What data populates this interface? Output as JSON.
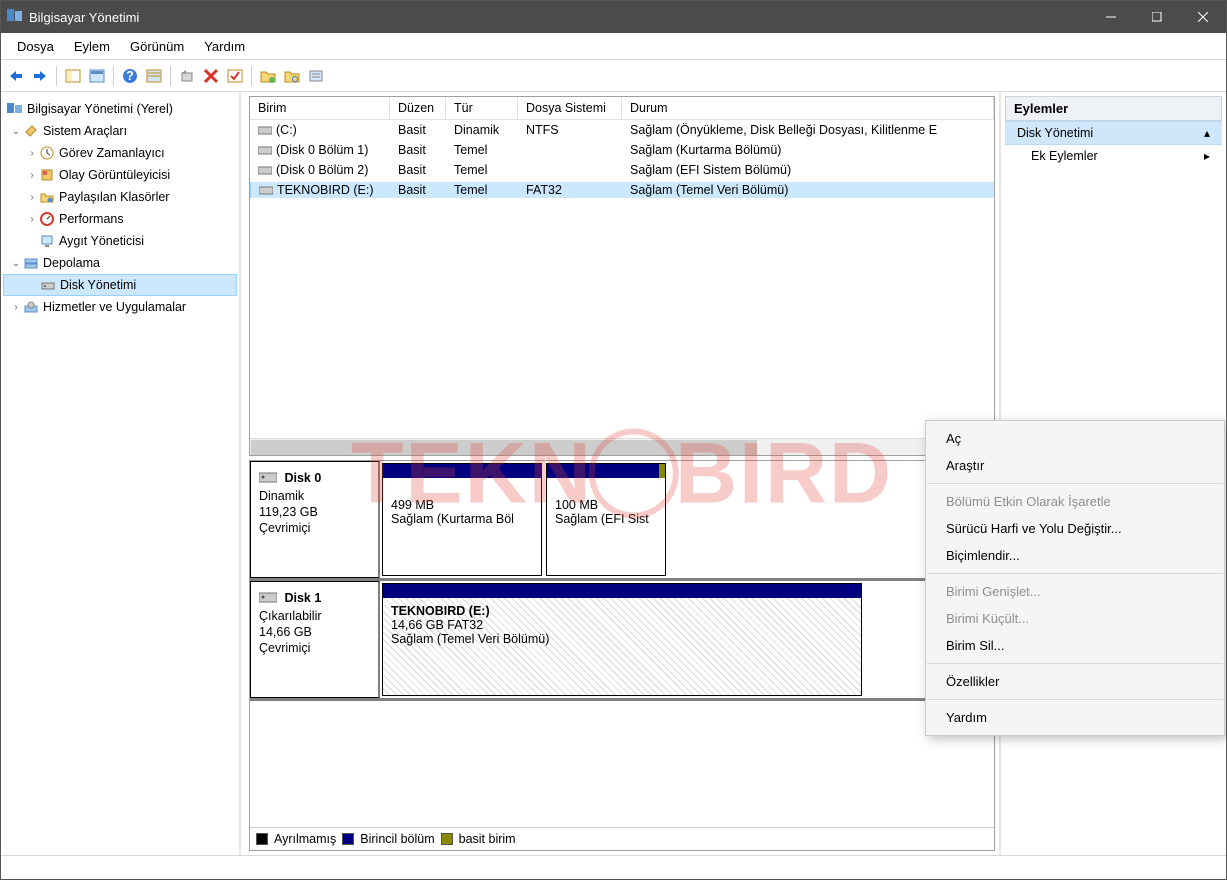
{
  "title": "Bilgisayar Yönetimi",
  "menubar": [
    "Dosya",
    "Eylem",
    "Görünüm",
    "Yardım"
  ],
  "tree": {
    "root": "Bilgisayar Yönetimi (Yerel)",
    "sys_tools": "Sistem Araçları",
    "task_sched": "Görev Zamanlayıcı",
    "event_viewer": "Olay Görüntüleyicisi",
    "shared": "Paylaşılan Klasörler",
    "perf": "Performans",
    "devmgr": "Aygıt Yöneticisi",
    "storage": "Depolama",
    "diskmgmt": "Disk Yönetimi",
    "services": "Hizmetler ve Uygulamalar"
  },
  "columns": [
    "Birim",
    "Düzen",
    "Tür",
    "Dosya Sistemi",
    "Durum"
  ],
  "volumes": [
    {
      "name": " (C:)",
      "layout": "Basit",
      "type": "Dinamik",
      "fs": "NTFS",
      "status": "Sağlam (Önyükleme, Disk Belleği Dosyası, Kilitlenme E"
    },
    {
      "name": " (Disk 0 Bölüm 1)",
      "layout": "Basit",
      "type": "Temel",
      "fs": "",
      "status": "Sağlam (Kurtarma Bölümü)"
    },
    {
      "name": " (Disk 0 Bölüm 2)",
      "layout": "Basit",
      "type": "Temel",
      "fs": "",
      "status": "Sağlam (EFI Sistem Bölümü)"
    },
    {
      "name": " TEKNOBIRD (E:)",
      "layout": "Basit",
      "type": "Temel",
      "fs": "FAT32",
      "status": "Sağlam (Temel Veri Bölümü)"
    }
  ],
  "disk0": {
    "title": "Disk 0",
    "l1": "Dinamik",
    "l2": "119,23 GB",
    "l3": "Çevrimiçi",
    "p1_size": "499 MB",
    "p1_status": "Sağlam (Kurtarma Böl",
    "p2_size": "100 MB",
    "p2_status": "Sağlam (EFI Sist"
  },
  "disk1": {
    "title": "Disk 1",
    "l1": "Çıkarılabilir",
    "l2": "14,66 GB",
    "l3": "Çevrimiçi",
    "p1_name": "TEKNOBIRD  (E:)",
    "p1_info": "14,66 GB FAT32",
    "p1_status": "Sağlam (Temel Veri Bölümü)"
  },
  "legend": {
    "unalloc": "Ayrılmamış",
    "primary": "Birincil bölüm",
    "simple": "basit birim"
  },
  "actions": {
    "header": "Eylemler",
    "dm": "Disk Yönetimi",
    "more": "Ek Eylemler"
  },
  "ctx": {
    "open": "Aç",
    "explore": "Araştır",
    "mark_active": "Bölümü Etkin Olarak İşaretle",
    "change_letter": "Sürücü Harfi ve Yolu Değiştir...",
    "format": "Biçimlendir...",
    "extend": "Birimi Genişlet...",
    "shrink": "Birimi Küçült...",
    "delete": "Birim Sil...",
    "props": "Özellikler",
    "help": "Yardım"
  },
  "watermark": "TEKNOBIRD"
}
